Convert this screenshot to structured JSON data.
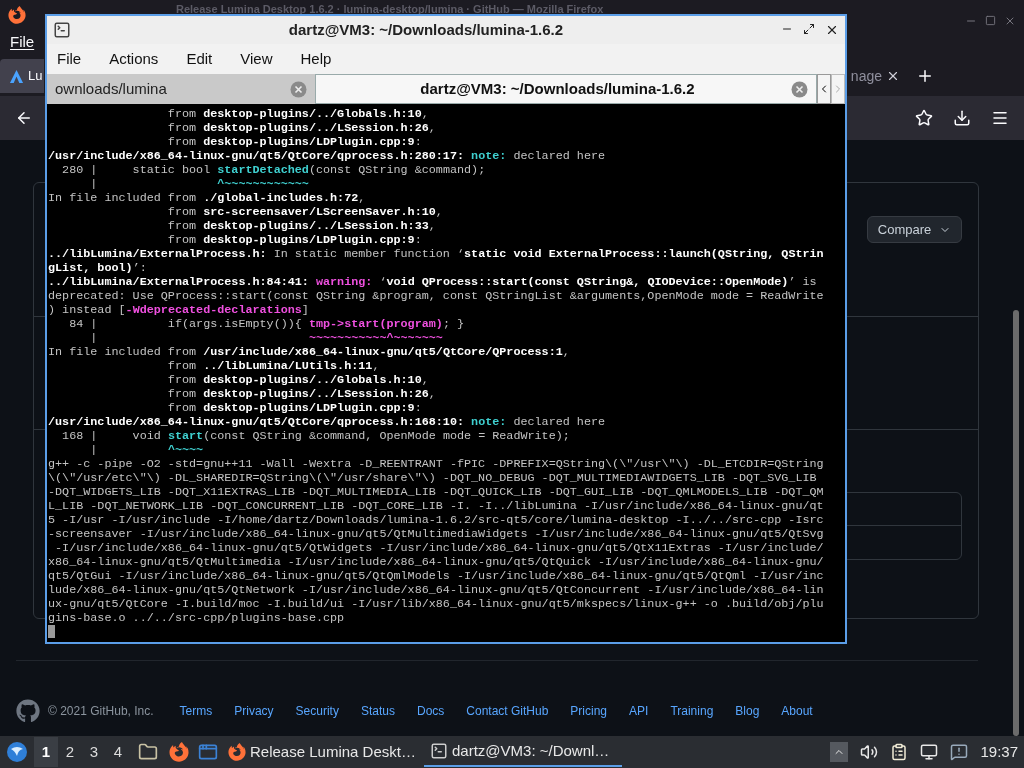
{
  "browser": {
    "title": "Release Lumina Desktop 1.6.2 · lumina-desktop/lumina · GitHub — Mozilla Firefox",
    "menu": [
      "File"
    ],
    "tabs": [
      {
        "label": "Lu",
        "selected": true
      },
      {
        "label": "nage",
        "selected": false
      }
    ],
    "compare_button": "Compare",
    "footer": {
      "copyright": "© 2021 GitHub, Inc.",
      "links": [
        "Terms",
        "Privacy",
        "Security",
        "Status",
        "Docs",
        "Contact GitHub",
        "Pricing",
        "API",
        "Training",
        "Blog",
        "About"
      ]
    }
  },
  "terminal": {
    "title": "dartz@VM3: ~/Downloads/lumina-1.6.2",
    "menu": [
      "File",
      "Actions",
      "Edit",
      "View",
      "Help"
    ],
    "tabs": [
      {
        "label": "ownloads/lumina",
        "selected": false
      },
      {
        "label": "dartz@VM3: ~/Downloads/lumina-1.6.2",
        "selected": true
      }
    ],
    "lines": [
      [
        {
          "kind": "plain",
          "text": "                 from "
        },
        {
          "kind": "bold",
          "text": "desktop-plugins/../Globals.h:10"
        },
        {
          "kind": "plain",
          "text": ","
        }
      ],
      [
        {
          "kind": "plain",
          "text": "                 from "
        },
        {
          "kind": "bold",
          "text": "desktop-plugins/../LSession.h:26"
        },
        {
          "kind": "plain",
          "text": ","
        }
      ],
      [
        {
          "kind": "plain",
          "text": "                 from "
        },
        {
          "kind": "bold",
          "text": "desktop-plugins/LDPlugin.cpp:9"
        },
        {
          "kind": "plain",
          "text": ":"
        }
      ],
      [
        {
          "kind": "bold",
          "text": "/usr/include/x86_64-linux-gnu/qt5/QtCore/qprocess.h:280:17: "
        },
        {
          "kind": "cyan",
          "text": "note:"
        },
        {
          "kind": "plain",
          "text": " declared here"
        }
      ],
      [
        {
          "kind": "plain",
          "text": "  280 |     static bool "
        },
        {
          "kind": "cyan",
          "text": "startDetached"
        },
        {
          "kind": "plain",
          "text": "(const QString &command);"
        }
      ],
      [
        {
          "kind": "plain",
          "text": "      |                 "
        },
        {
          "kind": "cyan",
          "text": "^~~~~~~~~~~~~"
        }
      ],
      [
        {
          "kind": "plain",
          "text": "In file included from "
        },
        {
          "kind": "bold",
          "text": "./global-includes.h:72"
        },
        {
          "kind": "plain",
          "text": ","
        }
      ],
      [
        {
          "kind": "plain",
          "text": "                 from "
        },
        {
          "kind": "bold",
          "text": "src-screensaver/LScreenSaver.h:10"
        },
        {
          "kind": "plain",
          "text": ","
        }
      ],
      [
        {
          "kind": "plain",
          "text": "                 from "
        },
        {
          "kind": "bold",
          "text": "desktop-plugins/../LSession.h:33"
        },
        {
          "kind": "plain",
          "text": ","
        }
      ],
      [
        {
          "kind": "plain",
          "text": "                 from "
        },
        {
          "kind": "bold",
          "text": "desktop-plugins/LDPlugin.cpp:9"
        },
        {
          "kind": "plain",
          "text": ":"
        }
      ],
      [
        {
          "kind": "bold",
          "text": "../libLumina/ExternalProcess.h:"
        },
        {
          "kind": "plain",
          "text": " In static member function ‘"
        },
        {
          "kind": "bold",
          "text": "static void ExternalProcess::launch(QString, QStrin"
        }
      ],
      [
        {
          "kind": "bold",
          "text": "gList, bool)"
        },
        {
          "kind": "plain",
          "text": "’:"
        }
      ],
      [
        {
          "kind": "bold",
          "text": "../libLumina/ExternalProcess.h:84:41: "
        },
        {
          "kind": "magenta",
          "text": "warning:"
        },
        {
          "kind": "plain",
          "text": " ‘"
        },
        {
          "kind": "bold",
          "text": "void QProcess::start(const QString&, QIODevice::OpenMode)"
        },
        {
          "kind": "plain",
          "text": "’ is"
        }
      ],
      [
        {
          "kind": "plain",
          "text": "deprecated: Use QProcess::start(const QString &program, const QStringList &arguments,OpenMode mode = ReadWrite"
        }
      ],
      [
        {
          "kind": "plain",
          "text": ") instead ["
        },
        {
          "kind": "magenta",
          "text": "-Wdeprecated-declarations"
        },
        {
          "kind": "plain",
          "text": "]"
        }
      ],
      [
        {
          "kind": "plain",
          "text": "   84 |          if(args.isEmpty()){ "
        },
        {
          "kind": "magenta",
          "text": "tmp->start(program)"
        },
        {
          "kind": "plain",
          "text": "; }"
        }
      ],
      [
        {
          "kind": "plain",
          "text": "      |                              "
        },
        {
          "kind": "magenta",
          "text": "~~~~~~~~~~~^~~~~~~~"
        }
      ],
      [
        {
          "kind": "plain",
          "text": "In file included from "
        },
        {
          "kind": "bold",
          "text": "/usr/include/x86_64-linux-gnu/qt5/QtCore/QProcess:1"
        },
        {
          "kind": "plain",
          "text": ","
        }
      ],
      [
        {
          "kind": "plain",
          "text": "                 from "
        },
        {
          "kind": "bold",
          "text": "../libLumina/LUtils.h:11"
        },
        {
          "kind": "plain",
          "text": ","
        }
      ],
      [
        {
          "kind": "plain",
          "text": "                 from "
        },
        {
          "kind": "bold",
          "text": "desktop-plugins/../Globals.h:10"
        },
        {
          "kind": "plain",
          "text": ","
        }
      ],
      [
        {
          "kind": "plain",
          "text": "                 from "
        },
        {
          "kind": "bold",
          "text": "desktop-plugins/../LSession.h:26"
        },
        {
          "kind": "plain",
          "text": ","
        }
      ],
      [
        {
          "kind": "plain",
          "text": "                 from "
        },
        {
          "kind": "bold",
          "text": "desktop-plugins/LDPlugin.cpp:9"
        },
        {
          "kind": "plain",
          "text": ":"
        }
      ],
      [
        {
          "kind": "bold",
          "text": "/usr/include/x86_64-linux-gnu/qt5/QtCore/qprocess.h:168:10: "
        },
        {
          "kind": "cyan",
          "text": "note:"
        },
        {
          "kind": "plain",
          "text": " declared here"
        }
      ],
      [
        {
          "kind": "plain",
          "text": "  168 |     void "
        },
        {
          "kind": "cyan",
          "text": "start"
        },
        {
          "kind": "plain",
          "text": "(const QString &command, OpenMode mode = ReadWrite);"
        }
      ],
      [
        {
          "kind": "plain",
          "text": "      |          "
        },
        {
          "kind": "cyan",
          "text": "^~~~~"
        }
      ],
      [
        {
          "kind": "plain",
          "text": "g++ -c -pipe -O2 -std=gnu++11 -Wall -Wextra -D_REENTRANT -fPIC -DPREFIX=QString\\(\\\"/usr\\\"\\) -DL_ETCDIR=QString"
        }
      ],
      [
        {
          "kind": "plain",
          "text": "\\(\\\"/usr/etc\\\"\\) -DL_SHAREDIR=QString\\(\\\"/usr/share\\\"\\) -DQT_NO_DEBUG -DQT_MULTIMEDIAWIDGETS_LIB -DQT_SVG_LIB"
        }
      ],
      [
        {
          "kind": "plain",
          "text": "-DQT_WIDGETS_LIB -DQT_X11EXTRAS_LIB -DQT_MULTIMEDIA_LIB -DQT_QUICK_LIB -DQT_GUI_LIB -DQT_QMLMODELS_LIB -DQT_QM"
        }
      ],
      [
        {
          "kind": "plain",
          "text": "L_LIB -DQT_NETWORK_LIB -DQT_CONCURRENT_LIB -DQT_CORE_LIB -I. -I../libLumina -I/usr/include/x86_64-linux-gnu/qt"
        }
      ],
      [
        {
          "kind": "plain",
          "text": "5 -I/usr -I/usr/include -I/home/dartz/Downloads/lumina-1.6.2/src-qt5/core/lumina-desktop -I../../src-cpp -Isrc"
        }
      ],
      [
        {
          "kind": "plain",
          "text": "-screensaver -I/usr/include/x86_64-linux-gnu/qt5/QtMultimediaWidgets -I/usr/include/x86_64-linux-gnu/qt5/QtSvg"
        }
      ],
      [
        {
          "kind": "plain",
          "text": " -I/usr/include/x86_64-linux-gnu/qt5/QtWidgets -I/usr/include/x86_64-linux-gnu/qt5/QtX11Extras -I/usr/include/"
        }
      ],
      [
        {
          "kind": "plain",
          "text": "x86_64-linux-gnu/qt5/QtMultimedia -I/usr/include/x86_64-linux-gnu/qt5/QtQuick -I/usr/include/x86_64-linux-gnu/"
        }
      ],
      [
        {
          "kind": "plain",
          "text": "qt5/QtGui -I/usr/include/x86_64-linux-gnu/qt5/QtQmlModels -I/usr/include/x86_64-linux-gnu/qt5/QtQml -I/usr/inc"
        }
      ],
      [
        {
          "kind": "plain",
          "text": "lude/x86_64-linux-gnu/qt5/QtNetwork -I/usr/include/x86_64-linux-gnu/qt5/QtConcurrent -I/usr/include/x86_64-lin"
        }
      ],
      [
        {
          "kind": "plain",
          "text": "ux-gnu/qt5/QtCore -I.build/moc -I.build/ui -I/usr/lib/x86_64-linux-gnu/qt5/mkspecs/linux-g++ -o .build/obj/plu"
        }
      ],
      [
        {
          "kind": "plain",
          "text": "gins-base.o ../../src-cpp/plugins-base.cpp"
        }
      ]
    ]
  },
  "taskbar": {
    "workspaces": [
      {
        "label": "1",
        "selected": true
      },
      {
        "label": "2",
        "selected": false
      },
      {
        "label": "3",
        "selected": false
      },
      {
        "label": "4",
        "selected": false
      }
    ],
    "tasks": [
      {
        "kind": "browser",
        "label": "Release Lumina Deskt…",
        "selected": false
      },
      {
        "kind": "terminal",
        "label": "dartz@VM3: ~/Downl…",
        "selected": true
      }
    ],
    "clock": "19:37"
  }
}
